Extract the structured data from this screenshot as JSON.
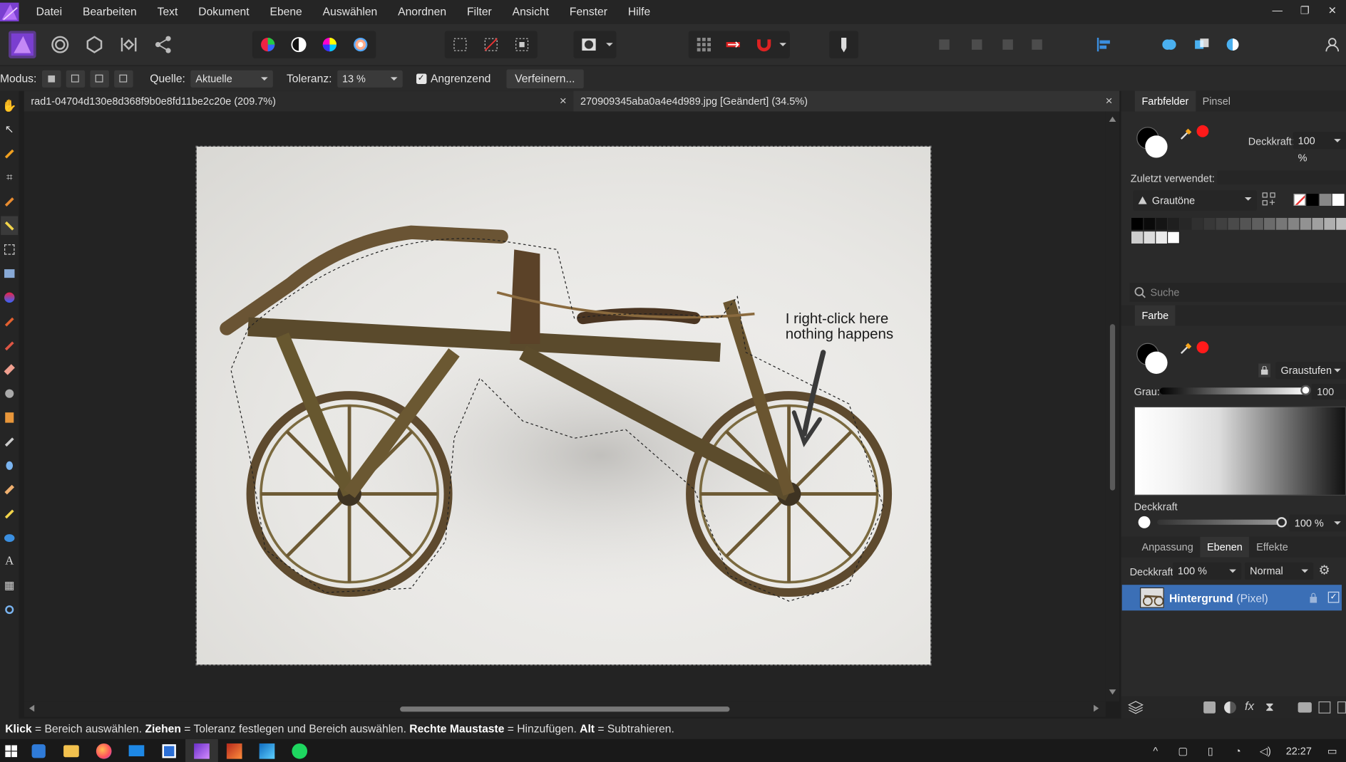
{
  "menubar": {
    "items": [
      "Datei",
      "Bearbeiten",
      "Text",
      "Dokument",
      "Ebene",
      "Auswählen",
      "Anordnen",
      "Filter",
      "Ansicht",
      "Fenster",
      "Hilfe"
    ]
  },
  "context_bar": {
    "mode_label": "Modus:",
    "source_label": "Quelle:",
    "source_value": "Aktuelle Ebene",
    "tolerance_label": "Toleranz:",
    "tolerance_value": "13 %",
    "contiguous_label": "Angrenzend",
    "contiguous_checked": true,
    "refine_label": "Verfeinern..."
  },
  "documents": {
    "tabs": [
      {
        "label": "rad1-04704d130e8d368f9b0e8fd11be2c20e (209.7%)",
        "active": false
      },
      {
        "label": "270909345aba0a4e4d989.jpg [Geändert] (34.5%)",
        "active": true
      }
    ]
  },
  "canvas": {
    "annotation_line1": "I right-click here",
    "annotation_line2": "nothing happens"
  },
  "swatches_panel": {
    "tab_swatches": "Farbfelder",
    "tab_brush": "Pinsel",
    "opacity_label": "Deckkraft:",
    "opacity_value": "100 %",
    "recent_label": "Zuletzt verwendet:",
    "palette_value": "Grautöne",
    "search_placeholder": "Suche"
  },
  "color_panel": {
    "tab": "Farbe",
    "mode_value": "Graustufen",
    "gray_label": "Grau:",
    "gray_value": "100",
    "opacity_label": "Deckkraft",
    "opacity_value": "100 %"
  },
  "layers_panel": {
    "tab_adjust": "Anpassung",
    "tab_layers": "Ebenen",
    "tab_effects": "Effekte",
    "opacity_label": "Deckkraft:",
    "opacity_value": "100 %",
    "blend_value": "Normal",
    "layer_name": "Hintergrund",
    "layer_type": "(Pixel)"
  },
  "statusbar": {
    "p1b": "Klick",
    "p1": " = Bereich auswählen. ",
    "p2b": "Ziehen",
    "p2": " = Toleranz festlegen und Bereich auswählen. ",
    "p3b": "Rechte Maustaste",
    "p3": " = Hinzufügen. ",
    "p4b": "Alt",
    "p4": " = Subtrahieren."
  },
  "taskbar": {
    "clock": "22:27"
  },
  "colors": {
    "accent": "#3b6fb6",
    "brand": "#7a3fd0",
    "red_swatch": "#ff1a1a"
  }
}
